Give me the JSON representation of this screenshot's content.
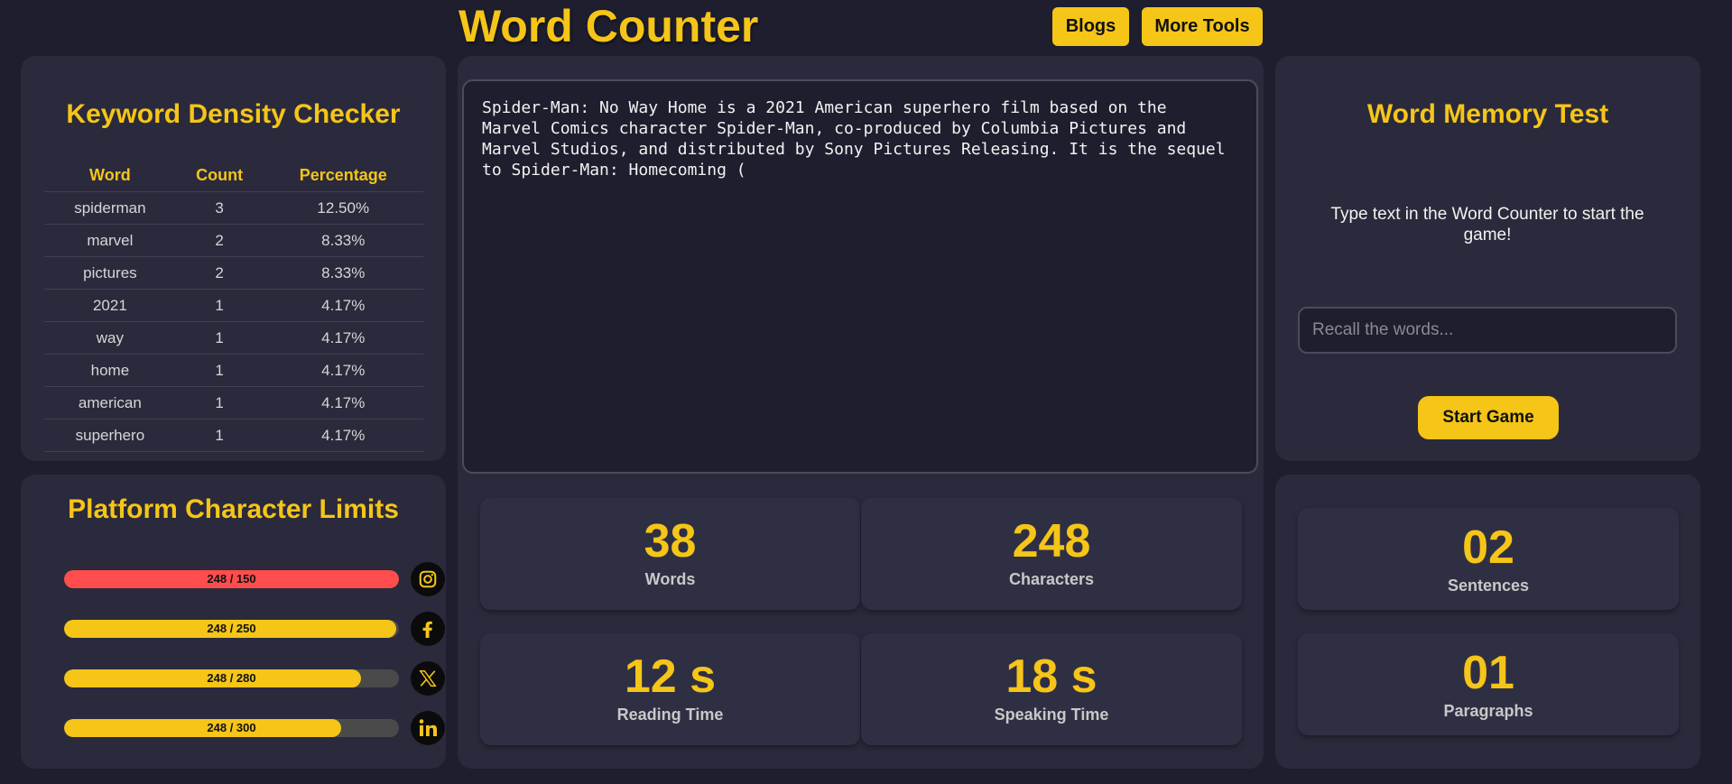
{
  "header": {
    "title": "Word Counter",
    "blogs_label": "Blogs",
    "more_tools_label": "More Tools"
  },
  "keyword_density": {
    "title": "Keyword Density Checker",
    "columns": [
      "Word",
      "Count",
      "Percentage"
    ],
    "rows": [
      {
        "word": "spiderman",
        "count": "3",
        "percentage": "12.50%"
      },
      {
        "word": "marvel",
        "count": "2",
        "percentage": "8.33%"
      },
      {
        "word": "pictures",
        "count": "2",
        "percentage": "8.33%"
      },
      {
        "word": "2021",
        "count": "1",
        "percentage": "4.17%"
      },
      {
        "word": "way",
        "count": "1",
        "percentage": "4.17%"
      },
      {
        "word": "home",
        "count": "1",
        "percentage": "4.17%"
      },
      {
        "word": "american",
        "count": "1",
        "percentage": "4.17%"
      },
      {
        "word": "superhero",
        "count": "1",
        "percentage": "4.17%"
      }
    ]
  },
  "platform_limits": {
    "title": "Platform Character Limits",
    "items": [
      {
        "platform": "instagram",
        "text": "248 / 150",
        "fill": 1.0,
        "color": "#ff4d4d",
        "icon": "instagram-icon"
      },
      {
        "platform": "facebook",
        "text": "248 / 250",
        "fill": 0.992,
        "color": "#f5c518",
        "icon": "facebook-icon"
      },
      {
        "platform": "x",
        "text": "248 / 280",
        "fill": 0.886,
        "color": "#f5c518",
        "icon": "x-icon"
      },
      {
        "platform": "linkedin",
        "text": "248 / 300",
        "fill": 0.827,
        "color": "#f5c518",
        "icon": "linkedin-icon"
      }
    ]
  },
  "editor": {
    "text": "Spider-Man: No Way Home is a 2021 American superhero film based on the\nMarvel Comics character Spider-Man, co-produced by Columbia Pictures and\nMarvel Studios, and distributed by Sony Pictures Releasing. It is the sequel\nto Spider-Man: Homecoming ("
  },
  "stats": {
    "words": {
      "value": "38",
      "label": "Words"
    },
    "characters": {
      "value": "248",
      "label": "Characters"
    },
    "reading_time": {
      "value": "12 s",
      "label": "Reading Time"
    },
    "speaking_time": {
      "value": "18 s",
      "label": "Speaking Time"
    },
    "sentences": {
      "value": "02",
      "label": "Sentences"
    },
    "paragraphs": {
      "value": "01",
      "label": "Paragraphs"
    }
  },
  "memory_test": {
    "title": "Word Memory Test",
    "message": "Type text in the Word Counter to start the game!",
    "input_placeholder": "Recall the words...",
    "start_label": "Start Game"
  },
  "colors": {
    "accent": "#f5c518",
    "background": "#1e1e2e",
    "panel": "#2a2a3c",
    "over_limit": "#ff4d4d"
  }
}
